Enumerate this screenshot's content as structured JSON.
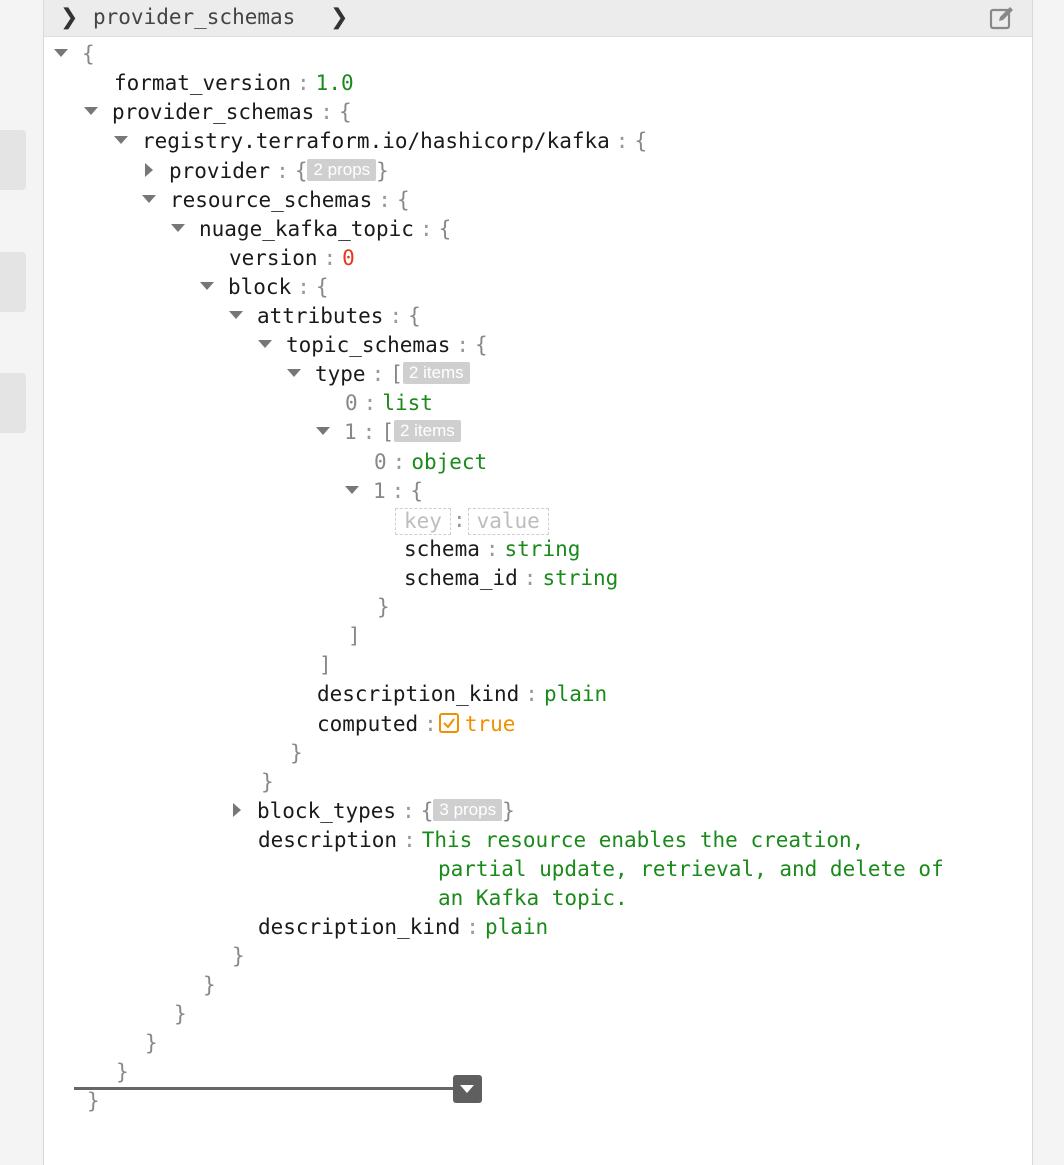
{
  "breadcrumb": {
    "path": "provider_schemas"
  },
  "tree": {
    "format_version_key": "format_version",
    "format_version_val": "1.0",
    "provider_schemas_key": "provider_schemas",
    "registry_key": "registry.terraform.io/hashicorp/kafka",
    "provider_key": "provider",
    "provider_badge": "2 props",
    "resource_schemas_key": "resource_schemas",
    "topic_key": "nuage_kafka_topic",
    "version_key": "version",
    "version_val": "0",
    "block_key": "block",
    "attributes_key": "attributes",
    "topic_schemas_key": "topic_schemas",
    "type_key": "type",
    "type_badge": "2 items",
    "idx0": "0",
    "list_val": "list",
    "idx1": "1",
    "idx1_badge": "2 items",
    "object_val": "object",
    "key_placeholder": "key",
    "value_placeholder": "value",
    "schema_key": "schema",
    "schema_val": "string",
    "schema_id_key": "schema_id",
    "schema_id_val": "string",
    "description_kind_key": "description_kind",
    "description_kind_val": "plain",
    "computed_key": "computed",
    "computed_val": "true",
    "block_types_key": "block_types",
    "block_types_badge": "3 props",
    "description_key": "description",
    "description_line1": "This resource enables the creation,",
    "description_line2": "partial update, retrieval, and delete of",
    "description_line3": "an Kafka topic.",
    "description_kind2_key": "description_kind",
    "description_kind2_val": "plain"
  },
  "colors": {
    "string": "#1a8a1a",
    "number_zero": "#e8361c",
    "boolean": "#f09000",
    "brace": "#888888"
  }
}
